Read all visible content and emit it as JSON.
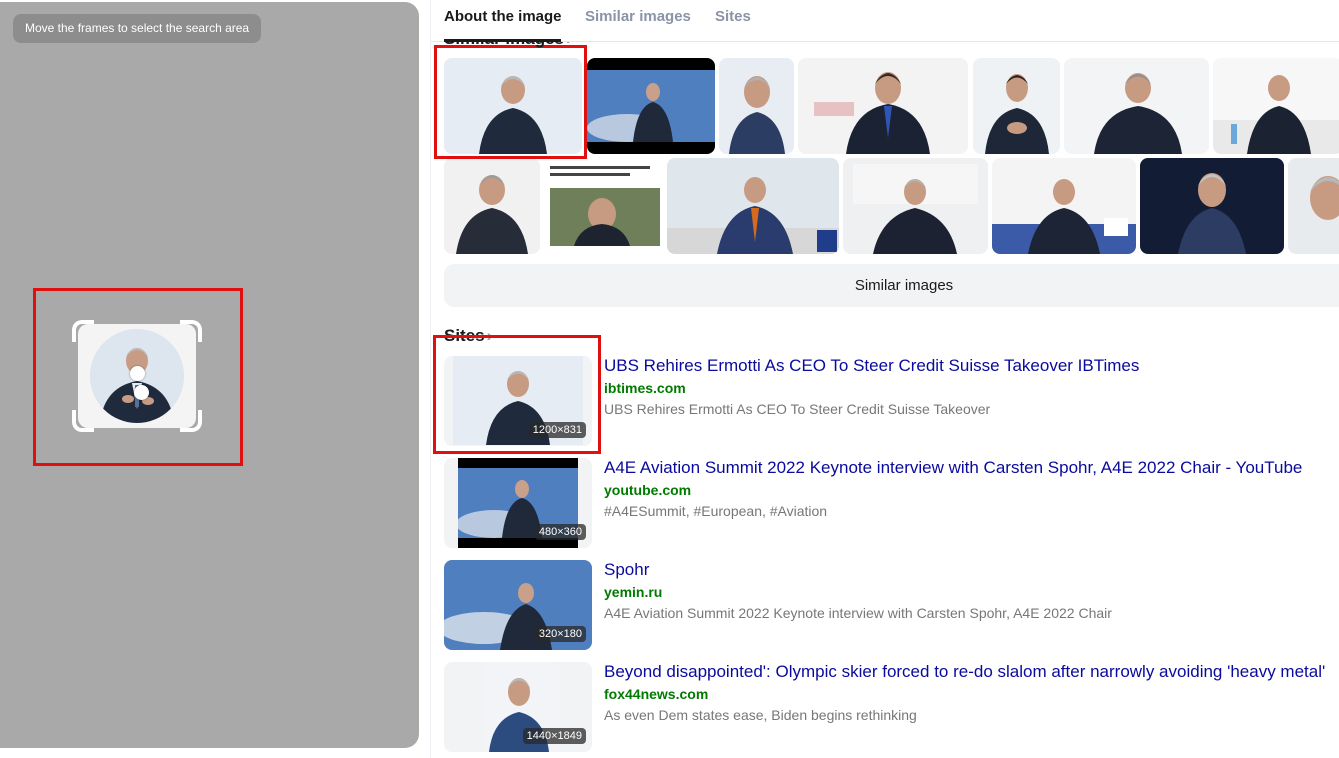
{
  "crop_panel": {
    "hint": "Move the frames to select the search area"
  },
  "tabs": [
    {
      "label": "About the image",
      "active": true
    },
    {
      "label": "Similar images",
      "active": false
    },
    {
      "label": "Sites",
      "active": false
    }
  ],
  "similar": {
    "title": "Similar images",
    "more_button": "Similar images"
  },
  "sites": {
    "title": "Sites",
    "items": [
      {
        "title": "UBS Rehires Ermotti As CEO To Steer Credit Suisse Takeover IBTimes",
        "domain": "ibtimes.com",
        "description": "UBS Rehires Ermotti As CEO To Steer Credit Suisse Takeover",
        "size": "1200×831"
      },
      {
        "title": "A4E Aviation Summit 2022 Keynote interview with Carsten Spohr, A4E 2022 Chair - YouTube",
        "domain": "youtube.com",
        "description": "#A4ESummit, #European, #Aviation",
        "size": "480×360"
      },
      {
        "title": "Spohr",
        "domain": "yemin.ru",
        "description": "A4E Aviation Summit 2022 Keynote interview with Carsten Spohr, A4E 2022 Chair",
        "size": "320×180"
      },
      {
        "title": "Beyond disappointed': Olympic skier forced to re-do slalom after narrowly avoiding 'heavy metal'",
        "domain": "fox44news.com",
        "description": "As even Dem states ease, Biden begins rethinking",
        "size": "1440×1849"
      }
    ]
  },
  "colors": {
    "highlight": "#e01010",
    "link": "#0a0a9e",
    "domain": "#007a00",
    "panel_gray": "#a9a9a9"
  }
}
